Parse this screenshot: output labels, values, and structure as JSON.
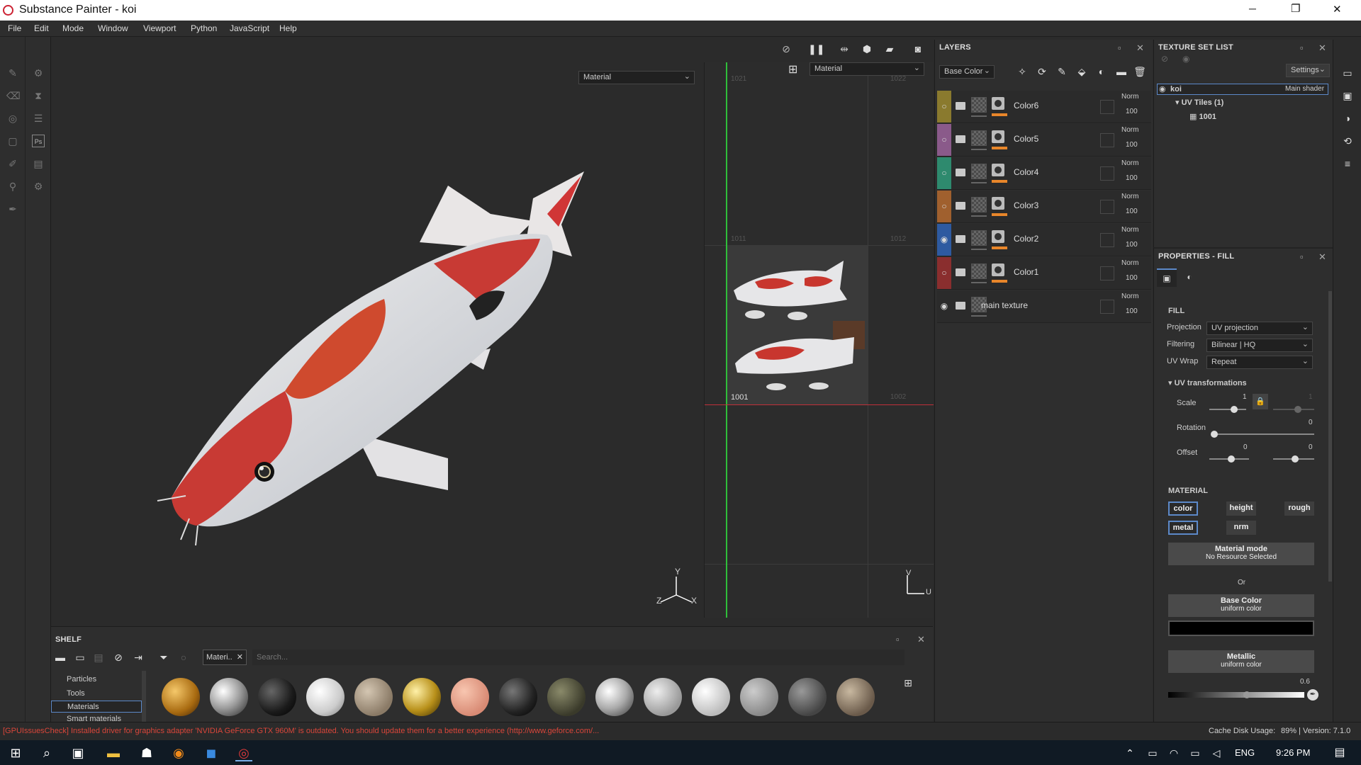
{
  "window": {
    "title": "Substance Painter - koi",
    "minimize": "─",
    "maximize": "❐",
    "close": "✕"
  },
  "menu": [
    "File",
    "Edit",
    "Mode",
    "Window",
    "Viewport",
    "Python",
    "JavaScript",
    "Help"
  ],
  "viewport": {
    "mode_select": "Material",
    "uv_mode_select": "Material",
    "axes": {
      "y": "Y",
      "z": "Z",
      "x": "X"
    },
    "uv_axes": {
      "v": "V",
      "u": "U"
    }
  },
  "uv": {
    "tiles": [
      "1021",
      "1022",
      "1011",
      "1012",
      "1001",
      "1002"
    ]
  },
  "layers": {
    "title": "LAYERS",
    "channel": "Base Color",
    "rows": [
      {
        "name": "Color6",
        "blend": "Norm",
        "opacity": "100",
        "color": "#8a7a2e",
        "eye": "○"
      },
      {
        "name": "Color5",
        "blend": "Norm",
        "opacity": "100",
        "color": "#8a5a8a",
        "eye": "○"
      },
      {
        "name": "Color4",
        "blend": "Norm",
        "opacity": "100",
        "color": "#2e8a6e",
        "eye": "○"
      },
      {
        "name": "Color3",
        "blend": "Norm",
        "opacity": "100",
        "color": "#a0602e",
        "eye": "○"
      },
      {
        "name": "Color2",
        "blend": "Norm",
        "opacity": "100",
        "color": "#2e5aa0",
        "eye": "◉"
      },
      {
        "name": "Color1",
        "blend": "Norm",
        "opacity": "100",
        "color": "#8a2e2e",
        "eye": "○"
      },
      {
        "name": "main texture",
        "blend": "Norm",
        "opacity": "100",
        "color": "#2b2b2b",
        "eye": "◉"
      }
    ]
  },
  "texture_set_list": {
    "title": "TEXTURE SET LIST",
    "settings": "Settings",
    "set": "koi",
    "shader": "Main shader",
    "uv_tiles": "UV Tiles (1)",
    "tile": "1001"
  },
  "properties": {
    "title": "PROPERTIES - FILL",
    "fill_heading": "FILL",
    "projection_label": "Projection",
    "projection": "UV projection",
    "filtering_label": "Filtering",
    "filtering": "Bilinear | HQ",
    "uvwrap_label": "UV Wrap",
    "uvwrap": "Repeat",
    "uvtrans": "UV transformations",
    "scale_label": "Scale",
    "scale": "1",
    "scale2": "1",
    "rotation_label": "Rotation",
    "rotation": "0",
    "offset_label": "Offset",
    "offset_x": "0",
    "offset_y": "0",
    "material_heading": "MATERIAL",
    "channels": [
      "color",
      "height",
      "rough",
      "metal",
      "nrm"
    ],
    "material_mode": "Material mode",
    "no_resource": "No Resource Selected",
    "or": "Or",
    "base_color": "Base Color",
    "base_color_sub": "uniform color",
    "metallic": "Metallic",
    "metallic_sub": "uniform color",
    "metallic_value": "0.6"
  },
  "shelf": {
    "title": "SHELF",
    "filter_tag": "Materi..",
    "search_placeholder": "Search...",
    "categories": [
      "Particles",
      "Tools",
      "Materials",
      "Smart materials"
    ]
  },
  "status": {
    "message": "[GPUIssuesCheck] Installed driver for graphics adapter 'NVIDIA GeForce GTX 960M' is outdated. You should update them for a better experience (http://www.geforce.com/...",
    "cache": "Cache Disk Usage:",
    "cache_value": "89% | Version: 7.1.0"
  },
  "taskbar": {
    "lang": "ENG",
    "time": "9:26 PM"
  }
}
